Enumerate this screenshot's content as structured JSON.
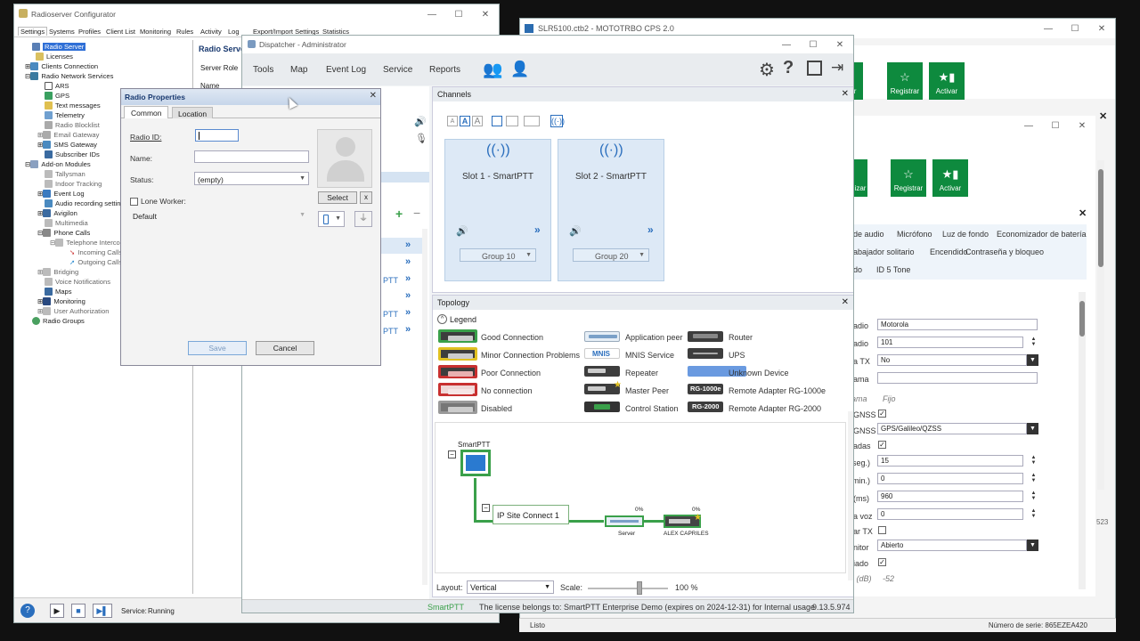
{
  "rc": {
    "title": "Radioserver Configurator",
    "tabs": [
      "Settings",
      "Systems",
      "Profiles",
      "Client List",
      "Monitoring",
      "Rules",
      "Activity",
      "Log",
      "Export/Import Settings",
      "Statistics"
    ],
    "tree": [
      "Radio Server",
      "Licenses",
      "Clients Connection",
      "Radio Network Services",
      "ARS",
      "GPS",
      "Text messages",
      "Telemetry",
      "Radio Blocklist",
      "Email Gateway",
      "SMS Gateway",
      "Subscriber IDs",
      "Add-on Modules",
      "Tallysman",
      "Indoor Tracking",
      "Event Log",
      "Audio recording settings",
      "Avigilon",
      "Multimedia",
      "Phone Calls",
      "Telephone Interconnect",
      "Incoming Calls",
      "Outgoing Calls",
      "Bridging",
      "Voice Notifications",
      "Maps",
      "Monitoring",
      "User Authorization",
      "Radio Groups"
    ],
    "panel_title": "Radio Server",
    "server_role": "Server Role",
    "name_label": "Name",
    "service_label": "Service:",
    "service_status": "Running"
  },
  "cps": {
    "title": "SLR5100.ctb2 - MOTOTRBO CPS 2.0",
    "btn_register": "Registrar",
    "btn_activate": "Activar",
    "btn_partial": "izar",
    "tabs_row1": [
      "de audio",
      "Micrófono",
      "Luz de fondo",
      "Economizador de batería"
    ],
    "tabs_row2": [
      "abajador solitario",
      "Encendido",
      "Contraseña y bloqueo"
    ],
    "tabs_row3": [
      "do",
      "ID 5 Tone"
    ],
    "labels": [
      "adio",
      "adio",
      "a TX",
      "ama",
      "llama",
      "GNSS",
      "GNSS",
      "adas",
      "(seg.)",
      "(min.)",
      "(ms)",
      "a voz",
      "ar TX",
      "nitor",
      "iado",
      "e (dB)"
    ],
    "values": {
      "v1": "Motorola",
      "v2": "101",
      "v3": "No",
      "fijo": "Fijo",
      "gnss_sys": "GPS/Galileo/QZSS",
      "v15": "15",
      "v0a": "0",
      "v960": "960",
      "v0b": "0",
      "abierto": "Abierto",
      "db": "-52"
    },
    "status": "Listo",
    "serial": "Número de serie: 865EZEA420",
    "side_num": "523"
  },
  "dispatcher": {
    "title": "Dispatcher - Administrator",
    "menu": [
      "Tools",
      "Map",
      "Event Log",
      "Service",
      "Reports"
    ],
    "channels_title": "Channels",
    "slot1": "Slot 1 - SmartPTT",
    "slot2": "Slot 2 - SmartPTT",
    "group1": "Group 10",
    "group2": "Group 20",
    "topology_title": "Topology",
    "legend_title": "Legend",
    "legend": [
      "Good Connection",
      "Minor Connection Problems",
      "Poor Connection",
      "No connection",
      "Disabled",
      "Application peer",
      "MNIS Service",
      "Repeater",
      "Master Peer",
      "Control Station",
      "Router",
      "UPS",
      "Unknown Device",
      "Remote Adapter RG-1000e",
      "Remote Adapter RG-2000"
    ],
    "mnis_badge": "MNIS",
    "rg1000_badge": "RG-1000e",
    "rg2000_badge": "RG-2000",
    "node_smartptt": "SmartPTT",
    "node_ipsite": "IP Site Connect 1",
    "node_server": "Server",
    "node_alex": "ALEX CAPRILES",
    "pct": "0%",
    "layout_label": "Layout:",
    "layout_value": "Vertical",
    "scale_label": "Scale:",
    "scale_value": "100 %",
    "status_app": "SmartPTT",
    "license": "The license belongs to: SmartPTT Enterprise Demo (expires on 2024-12-31) for Internal usage",
    "version": "9.13.5.974",
    "ptt_partial": "PTT"
  },
  "rp": {
    "title": "Radio Properties",
    "tab_common": "Common",
    "tab_location": "Location",
    "radio_id_label": "Radio ID:",
    "name_label": "Name:",
    "status_label": "Status:",
    "status_value": "(empty)",
    "lone_worker": "Lone Worker:",
    "default_value": "Default",
    "select_btn": "Select",
    "x_btn": "x",
    "save": "Save",
    "cancel": "Cancel"
  }
}
